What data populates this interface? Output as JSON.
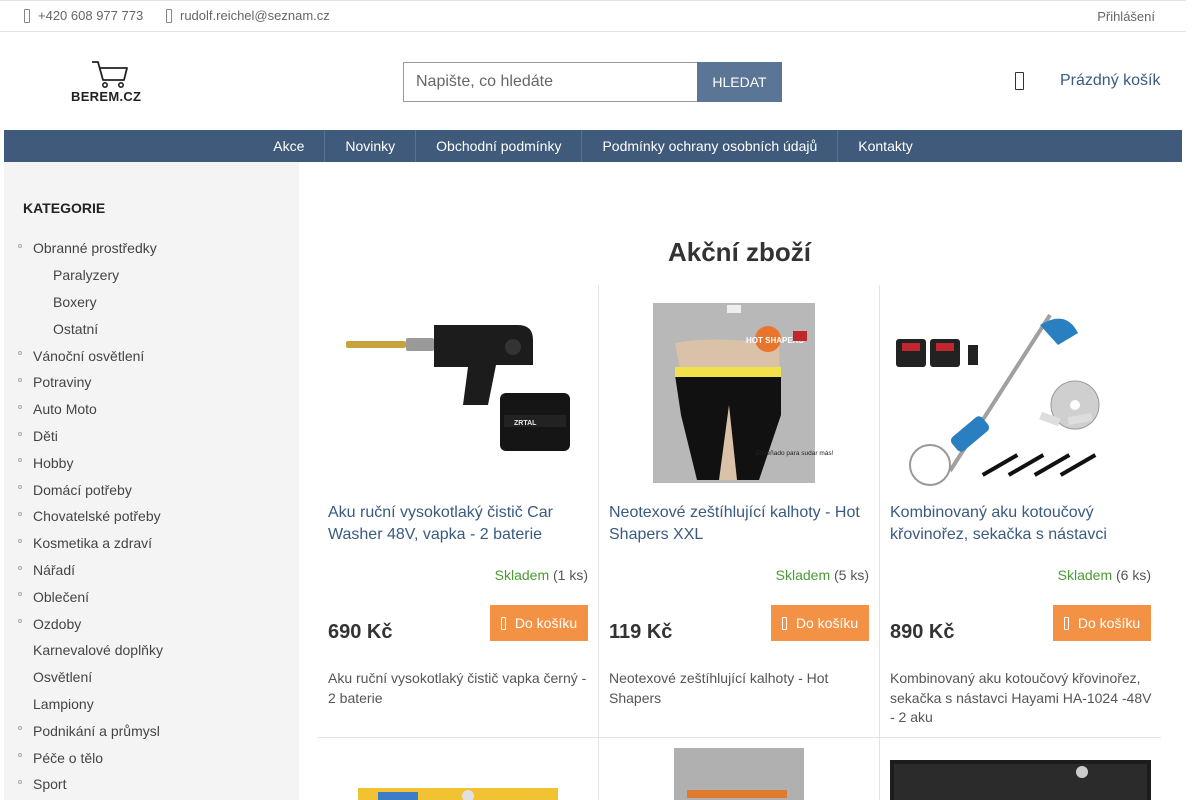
{
  "topbar": {
    "phone": "+420 608 977 773",
    "email": "rudolf.reichel@seznam.cz",
    "login": "Přihlášení"
  },
  "header": {
    "logo_text": "BEREM.CZ",
    "search_placeholder": "Napište, co hledáte",
    "search_button": "HLEDAT",
    "cart_label": "Prázdný košík"
  },
  "nav": [
    "Akce",
    "Novinky",
    "Obchodní podmínky",
    "Podmínky ochrany osobních údajů",
    "Kontakty"
  ],
  "sidebar": {
    "title": "KATEGORIE",
    "items": [
      {
        "label": "Obranné prostředky",
        "sub": false,
        "dot": true
      },
      {
        "label": "Paralyzery",
        "sub": true,
        "dot": false
      },
      {
        "label": "Boxery",
        "sub": true,
        "dot": false
      },
      {
        "label": "Ostatní",
        "sub": true,
        "dot": false
      },
      {
        "label": "Vánoční osvětlení",
        "sub": false,
        "dot": true
      },
      {
        "label": "Potraviny",
        "sub": false,
        "dot": true
      },
      {
        "label": "Auto Moto",
        "sub": false,
        "dot": true
      },
      {
        "label": "Děti",
        "sub": false,
        "dot": true
      },
      {
        "label": "Hobby",
        "sub": false,
        "dot": true
      },
      {
        "label": "Domácí potřeby",
        "sub": false,
        "dot": true
      },
      {
        "label": "Chovatelské potřeby",
        "sub": false,
        "dot": true
      },
      {
        "label": "Kosmetika a zdraví",
        "sub": false,
        "dot": true
      },
      {
        "label": "Nářadí",
        "sub": false,
        "dot": true
      },
      {
        "label": "Oblečení",
        "sub": false,
        "dot": true
      },
      {
        "label": "Ozdoby",
        "sub": false,
        "dot": true
      },
      {
        "label": "Karnevalové doplňky",
        "sub": false,
        "dot": false
      },
      {
        "label": "Osvětlení",
        "sub": false,
        "dot": false
      },
      {
        "label": "Lampiony",
        "sub": false,
        "dot": false
      },
      {
        "label": "Podnikání a průmysl",
        "sub": false,
        "dot": true
      },
      {
        "label": "Péče o tělo",
        "sub": false,
        "dot": true
      },
      {
        "label": "Sport",
        "sub": false,
        "dot": true
      }
    ]
  },
  "main": {
    "heading": "Akční zboží",
    "products": [
      {
        "title": "Aku ruční vysokotlaký čistič Car Washer 48V, vapka - 2 baterie",
        "stock_status": "Skladem",
        "stock_qty": "(1 ks)",
        "price": "690 Kč",
        "buy_label": "Do košíku",
        "description": "Aku ruční vysokotlaký čistič vapka černý - 2 baterie"
      },
      {
        "title": "Neotexové zeštíhlující kalhoty - Hot Shapers XXL",
        "stock_status": "Skladem",
        "stock_qty": "(5 ks)",
        "price": "119 Kč",
        "buy_label": "Do košíku",
        "description": "Neotexové zeštíhlující kalhoty - Hot Shapers"
      },
      {
        "title": "Kombinovaný aku kotoučový křovinořez, sekačka s nástavci",
        "stock_status": "Skladem",
        "stock_qty": "(6 ks)",
        "price": "890 Kč",
        "buy_label": "Do košíku",
        "description": "Kombinovaný aku kotoučový křovinořez, sekačka s nástavci Hayami HA-1024 -48V - 2 aku"
      }
    ],
    "product_image_texts": {
      "hot_shapers_logo": "HOT SHAPERS",
      "hot_shapers_tagline": "¡Diseñado para sudar más!",
      "washer_brand": "ZRTAL"
    }
  },
  "colors": {
    "nav_bg": "#3f5a7a",
    "search_button": "#5a7596",
    "buy_button": "#f39144",
    "in_stock": "#4a9a35",
    "link": "#3a5a80",
    "sidebar_bg": "#f4f4f4"
  },
  "icons": {
    "phone": "phone-icon",
    "email": "email-icon",
    "cart": "shopping-bag-icon",
    "buy": "shopping-bag-icon"
  }
}
